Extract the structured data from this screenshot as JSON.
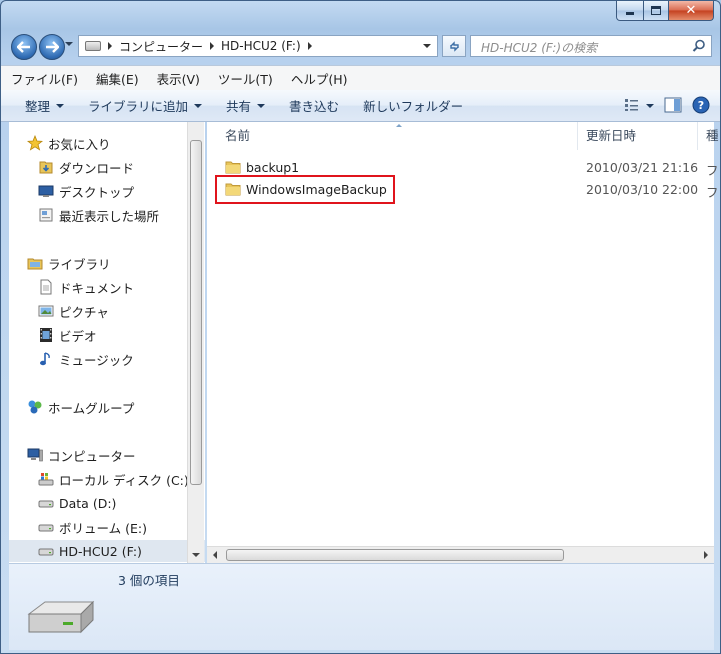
{
  "window": {
    "title": "HD-HCU2 (F:)",
    "controls": {
      "minimize": "—",
      "maximize": "□",
      "close": "✕"
    }
  },
  "address": {
    "crumbs": [
      "コンピューター",
      "HD-HCU2 (F:)"
    ],
    "search_placeholder": "HD-HCU2 (F:)の検索"
  },
  "menu": [
    "ファイル(F)",
    "編集(E)",
    "表示(V)",
    "ツール(T)",
    "ヘルプ(H)"
  ],
  "toolbar": {
    "organize": "整理",
    "add_to_library": "ライブラリに追加",
    "share": "共有",
    "burn": "書き込む",
    "new_folder": "新しいフォルダー"
  },
  "nav": {
    "favorites": {
      "label": "お気に入り",
      "items": [
        "ダウンロード",
        "デスクトップ",
        "最近表示した場所"
      ]
    },
    "libraries": {
      "label": "ライブラリ",
      "items": [
        "ドキュメント",
        "ピクチャ",
        "ビデオ",
        "ミュージック"
      ]
    },
    "homegroup": {
      "label": "ホームグループ"
    },
    "computer": {
      "label": "コンピューター",
      "items": [
        "ローカル ディスク (C:)",
        "Data (D:)",
        "ボリューム (E:)",
        "HD-HCU2 (F:)"
      ]
    }
  },
  "columns": {
    "name": "名前",
    "date": "更新日時",
    "type": "種"
  },
  "files": [
    {
      "name": "backup1",
      "date": "2010/03/21 21:16",
      "type": "フ"
    },
    {
      "name": "WindowsImageBackup",
      "date": "2010/03/10 22:00",
      "type": "フ"
    }
  ],
  "status": {
    "item_count": "3 個の項目"
  },
  "colors": {
    "highlight": "#e0141c",
    "folder": "#e8c55a",
    "accent": "#2f6bb3"
  }
}
